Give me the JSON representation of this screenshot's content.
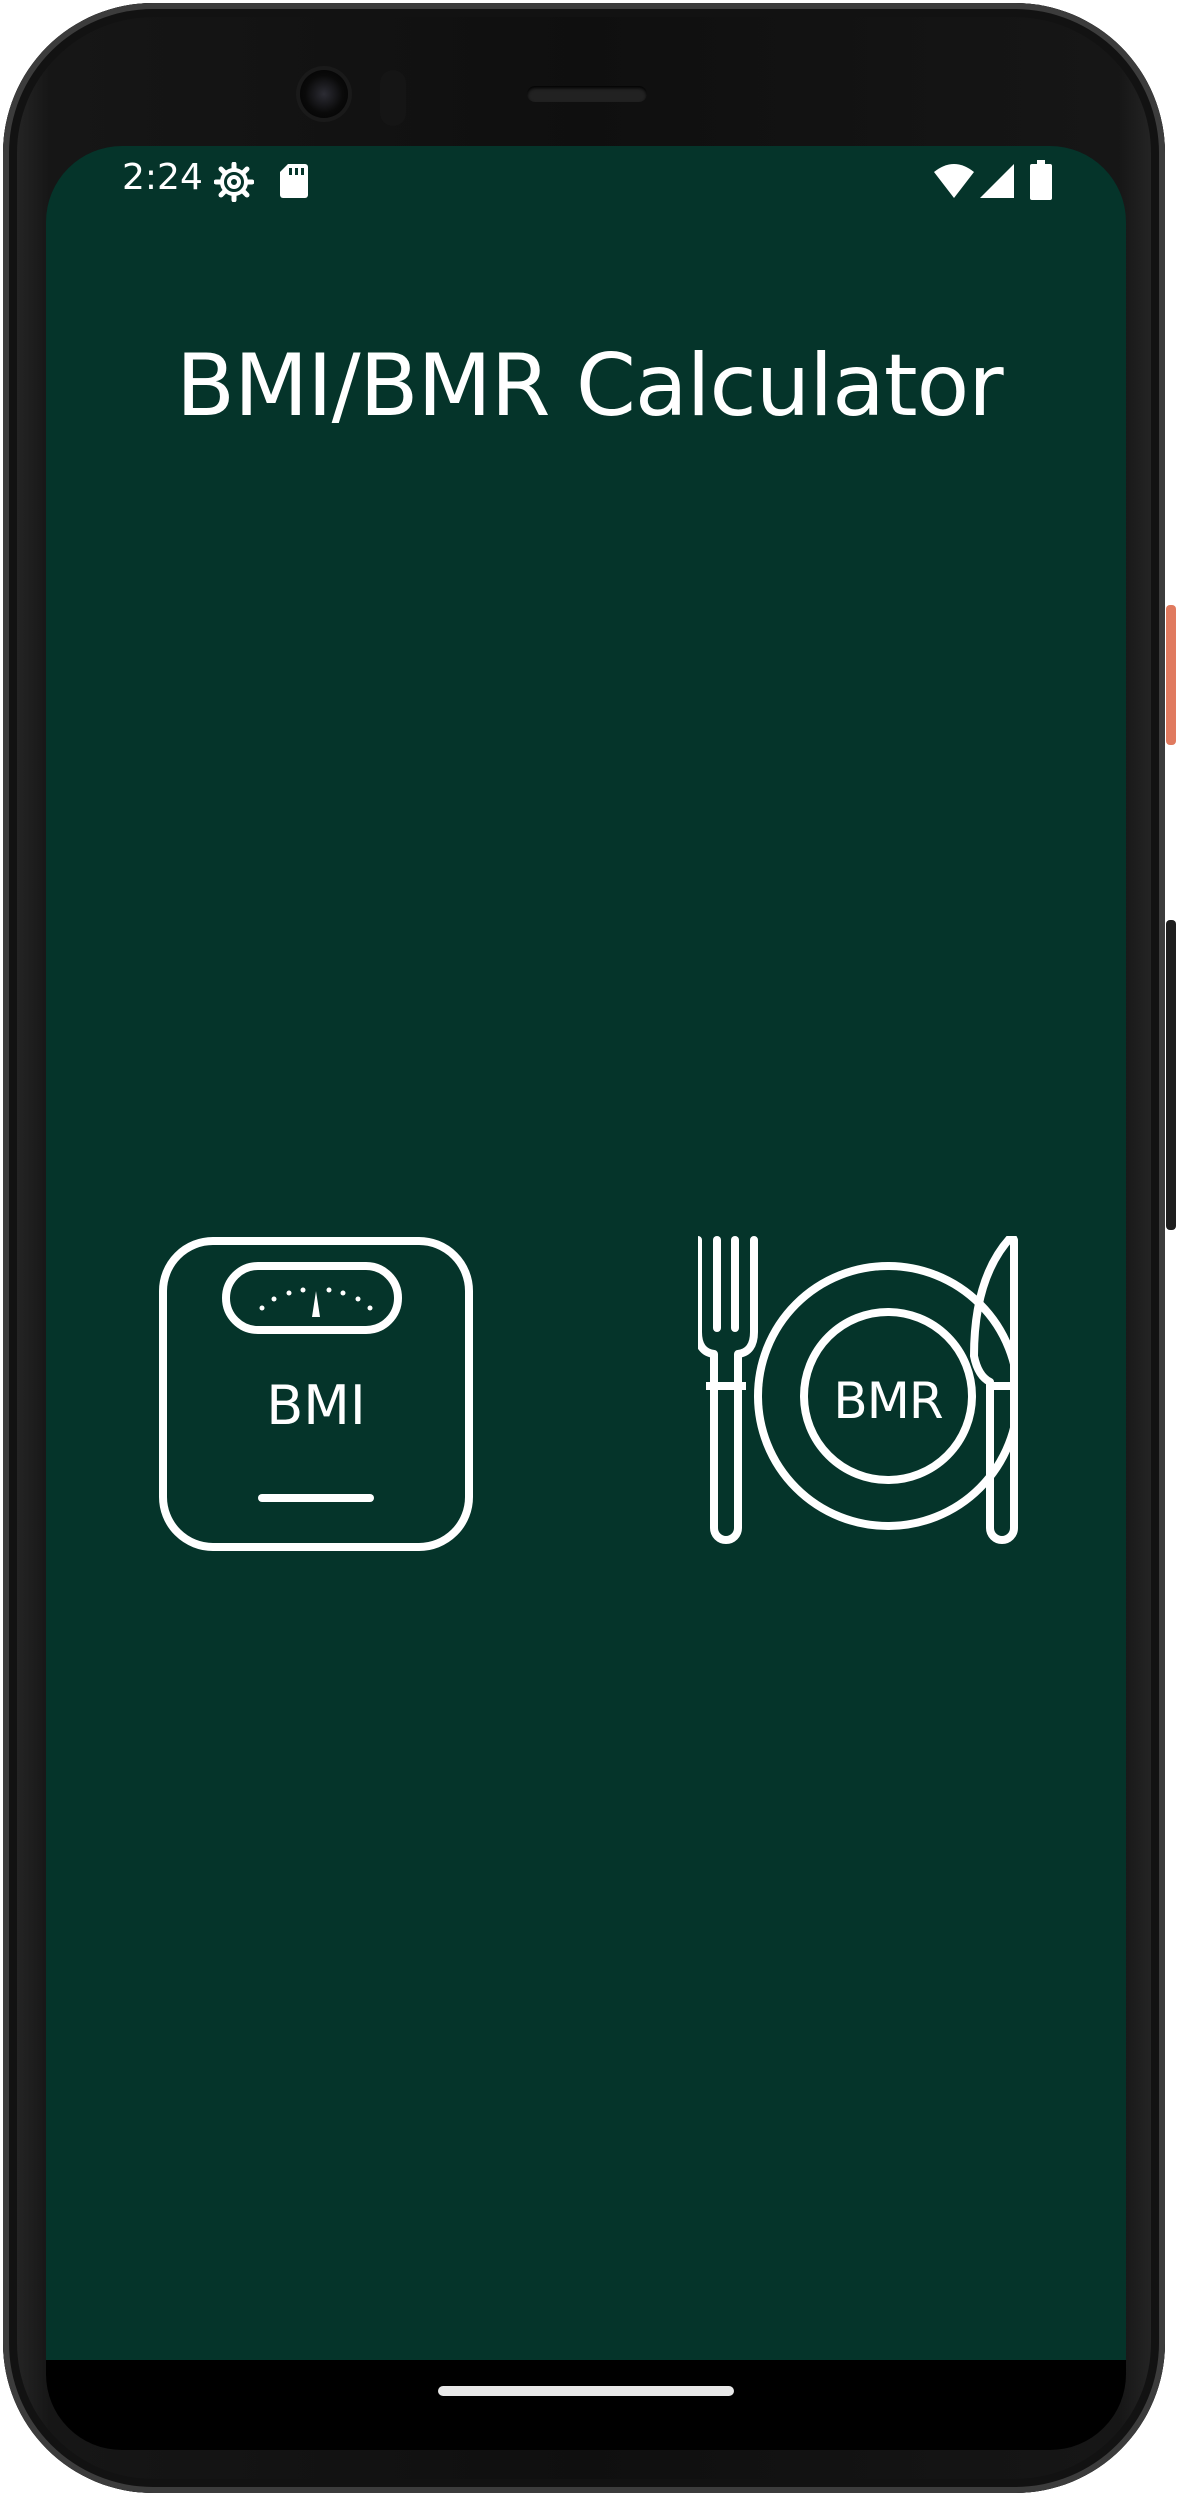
{
  "status_bar": {
    "time": "2:24",
    "left_icons": [
      "settings-gear-icon",
      "sd-card-icon"
    ],
    "right_icons": [
      "wifi-icon",
      "cell-signal-icon",
      "battery-icon"
    ]
  },
  "app": {
    "title": "BMI/BMR Calculator"
  },
  "menu": {
    "bmi": {
      "label": "BMI",
      "icon": "weighing-scale-icon"
    },
    "bmr": {
      "label": "BMR",
      "icon": "plate-fork-knife-icon"
    }
  },
  "colors": {
    "background": "#05342a",
    "foreground": "#ffffff"
  }
}
